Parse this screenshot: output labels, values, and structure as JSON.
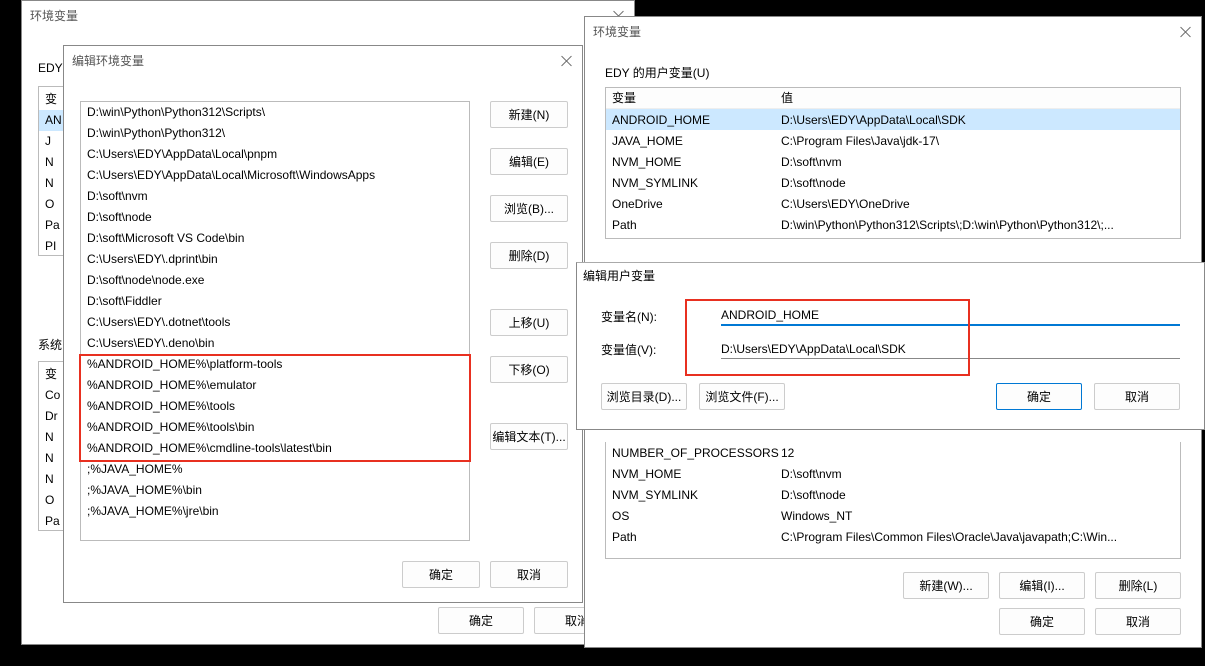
{
  "leftFragment": {
    "edy": "EDY",
    "sys": "系统",
    "sideTop": [
      "变",
      "AN",
      "J",
      "N",
      "N",
      "O",
      "Pa",
      "PI"
    ],
    "sideBot": [
      "变",
      "Co",
      "Dr",
      "N",
      "N",
      "N",
      "O",
      "Pa"
    ]
  },
  "dlgEdit": {
    "title": "编辑环境变量",
    "items": [
      "D:\\win\\Python\\Python312\\Scripts\\",
      "D:\\win\\Python\\Python312\\",
      "C:\\Users\\EDY\\AppData\\Local\\pnpm",
      "C:\\Users\\EDY\\AppData\\Local\\Microsoft\\WindowsApps",
      "D:\\soft\\nvm",
      "D:\\soft\\node",
      "D:\\soft\\Microsoft VS Code\\bin",
      "C:\\Users\\EDY\\.dprint\\bin",
      "D:\\soft\\node\\node.exe",
      "D:\\soft\\Fiddler",
      "C:\\Users\\EDY\\.dotnet\\tools",
      "C:\\Users\\EDY\\.deno\\bin",
      "%ANDROID_HOME%\\platform-tools",
      "%ANDROID_HOME%\\emulator",
      "%ANDROID_HOME%\\tools",
      "%ANDROID_HOME%\\tools\\bin",
      "%ANDROID_HOME%\\cmdline-tools\\latest\\bin",
      ";%JAVA_HOME%",
      ";%JAVA_HOME%\\bin",
      ";%JAVA_HOME%\\jre\\bin"
    ],
    "buttons": {
      "new": "新建(N)",
      "edit": "编辑(E)",
      "browse": "浏览(B)...",
      "delete": "删除(D)",
      "up": "上移(U)",
      "down": "下移(O)",
      "editText": "编辑文本(T)...",
      "ok": "确定",
      "cancel": "取消"
    }
  },
  "dlgEnvBack": {
    "title": "环境变量",
    "ok": "确定",
    "cancel": "取消"
  },
  "dlgEnvRight": {
    "title": "环境变量",
    "userGroup": "EDY 的用户变量(U)",
    "tableHeader": {
      "name": "变量",
      "value": "值"
    },
    "userRows": [
      {
        "name": "ANDROID_HOME",
        "value": "D:\\Users\\EDY\\AppData\\Local\\SDK",
        "sel": true
      },
      {
        "name": "JAVA_HOME",
        "value": "C:\\Program Files\\Java\\jdk-17\\"
      },
      {
        "name": "NVM_HOME",
        "value": "D:\\soft\\nvm"
      },
      {
        "name": "NVM_SYMLINK",
        "value": "D:\\soft\\node"
      },
      {
        "name": "OneDrive",
        "value": "C:\\Users\\EDY\\OneDrive"
      },
      {
        "name": "Path",
        "value": "D:\\win\\Python\\Python312\\Scripts\\;D:\\win\\Python\\Python312\\;..."
      }
    ],
    "sysRows": [
      {
        "name": "NUMBER_OF_PROCESSORS",
        "value": "12"
      },
      {
        "name": "NVM_HOME",
        "value": "D:\\soft\\nvm"
      },
      {
        "name": "NVM_SYMLINK",
        "value": "D:\\soft\\node"
      },
      {
        "name": "OS",
        "value": "Windows_NT"
      },
      {
        "name": "Path",
        "value": "C:\\Program Files\\Common Files\\Oracle\\Java\\javapath;C:\\Win..."
      }
    ],
    "buttons": {
      "new": "新建(W)...",
      "edit": "编辑(I)...",
      "del": "删除(L)",
      "ok": "确定",
      "cancel": "取消"
    }
  },
  "dlgEditVar": {
    "title": "编辑用户变量",
    "labelName": "变量名(N):",
    "labelValue": "变量值(V):",
    "name": "ANDROID_HOME",
    "value": "D:\\Users\\EDY\\AppData\\Local\\SDK",
    "browseDir": "浏览目录(D)...",
    "browseFile": "浏览文件(F)...",
    "ok": "确定",
    "cancel": "取消"
  }
}
